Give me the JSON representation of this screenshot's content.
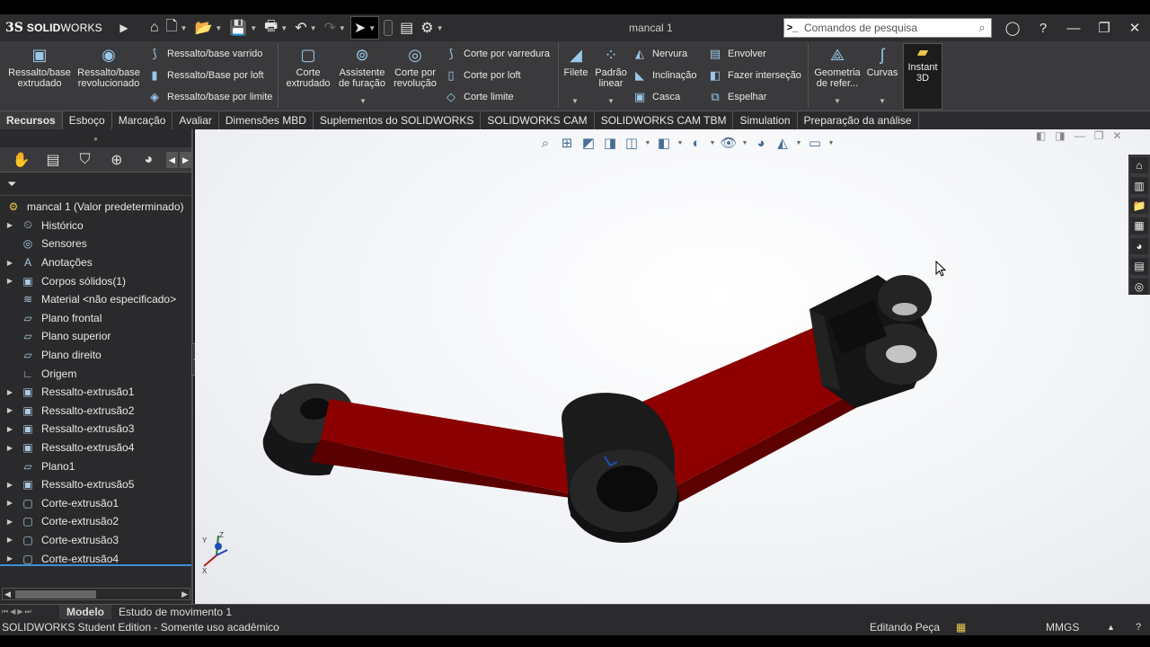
{
  "app": {
    "brand_ds": "3S",
    "brand_name_bold": "SOLID",
    "brand_name_rest": "WORKS",
    "document_title": "mancal 1"
  },
  "search": {
    "placeholder": "Comandos de pesquisa"
  },
  "ribbon": {
    "buttons_large": [
      {
        "label": "Ressalto/base\nextrudado"
      },
      {
        "label": "Ressalto/base\nrevolucionado"
      },
      {
        "label": "Corte\nextrudado"
      },
      {
        "label": "Assistente\nde furação"
      },
      {
        "label": "Corte por\nrevolução"
      },
      {
        "label": "Filete"
      },
      {
        "label": "Padrão\nlinear"
      },
      {
        "label": "Geometria\nde refer..."
      },
      {
        "label": "Curvas"
      },
      {
        "label": "Instant\n3D"
      }
    ],
    "buttons_small": [
      {
        "label": "Ressalto/base varrido"
      },
      {
        "label": "Ressalto/Base por loft"
      },
      {
        "label": "Ressalto/base por limite"
      },
      {
        "label": "Corte por varredura"
      },
      {
        "label": "Corte por loft"
      },
      {
        "label": "Corte limite"
      },
      {
        "label": "Nervura"
      },
      {
        "label": "Inclinação"
      },
      {
        "label": "Casca"
      },
      {
        "label": "Envolver"
      },
      {
        "label": "Fazer interseção"
      },
      {
        "label": "Espelhar"
      }
    ]
  },
  "tabs": [
    {
      "label": "Recursos"
    },
    {
      "label": "Esboço"
    },
    {
      "label": "Marcação"
    },
    {
      "label": "Avaliar"
    },
    {
      "label": "Dimensões MBD"
    },
    {
      "label": "Suplementos do SOLIDWORKS"
    },
    {
      "label": "SOLIDWORKS CAM"
    },
    {
      "label": "SOLIDWORKS CAM TBM"
    },
    {
      "label": "Simulation"
    },
    {
      "label": "Preparação da análise"
    }
  ],
  "tree": {
    "root": "mancal 1 (Valor predeterminado)",
    "items": [
      {
        "label": "Histórico"
      },
      {
        "label": "Sensores"
      },
      {
        "label": "Anotações"
      },
      {
        "label": "Corpos sólidos(1)"
      },
      {
        "label": "Material <não especificado>"
      },
      {
        "label": "Plano frontal"
      },
      {
        "label": "Plano superior"
      },
      {
        "label": "Plano direito"
      },
      {
        "label": "Origem"
      },
      {
        "label": "Ressalto-extrusão1"
      },
      {
        "label": "Ressalto-extrusão2"
      },
      {
        "label": "Ressalto-extrusão3"
      },
      {
        "label": "Ressalto-extrusão4"
      },
      {
        "label": "Plano1"
      },
      {
        "label": "Ressalto-extrusão5"
      },
      {
        "label": "Corte-extrusão1"
      },
      {
        "label": "Corte-extrusão2"
      },
      {
        "label": "Corte-extrusão3"
      },
      {
        "label": "Corte-extrusão4"
      }
    ]
  },
  "triad": {
    "x": "X",
    "y": "Y",
    "z": "Z"
  },
  "bottom_tabs": [
    {
      "label": "Modelo"
    },
    {
      "label": "Estudo de movimento 1"
    }
  ],
  "status": {
    "left": "SOLIDWORKS Student Edition - Somente uso acadêmico",
    "mode": "Editando Peça",
    "units": "MMGS"
  },
  "colors": {
    "arm": "#8b0000",
    "hub": "#1a1a1a",
    "accent": "#3d8fd6"
  }
}
